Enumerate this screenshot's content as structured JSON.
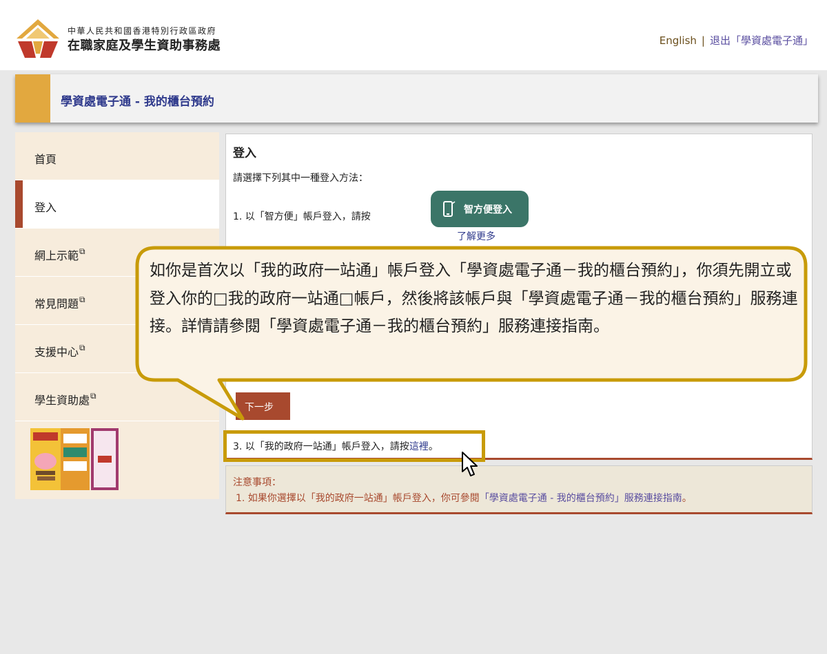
{
  "header": {
    "org_line1": "中華人民共和國香港特別行政區政府",
    "org_line2": "在職家庭及學生資助事務處",
    "english_link": "English",
    "separator": "|",
    "logout_link": "退出「學資處電子通」"
  },
  "title_bar": {
    "title": "學資處電子通 - 我的櫃台預約"
  },
  "sidebar": {
    "items": [
      {
        "label": "首頁",
        "external": false,
        "active": false
      },
      {
        "label": "登入",
        "external": false,
        "active": true
      },
      {
        "label": "網上示範",
        "external": true,
        "active": false
      },
      {
        "label": "常見問題",
        "external": true,
        "active": false
      },
      {
        "label": "支援中心",
        "external": true,
        "active": false
      },
      {
        "label": "學生資助處",
        "external": true,
        "active": false
      }
    ],
    "external_icon": "external-link-icon"
  },
  "content": {
    "title": "登入",
    "instruction": "請選擇下列其中一種登入方法：",
    "option1_text": "1. 以「智方便」帳戶登入，請按",
    "iamsmart_button": "智方便登入",
    "learn_more": "了解更多",
    "next_button": "下一步",
    "option3_prefix": "3. 以「我的政府一站通」帳戶登入，請按",
    "option3_link": "這裡",
    "option3_suffix": "。"
  },
  "notes": {
    "title": "注意事項：",
    "line_prefix": "1. 如果你選擇以「我的政府一站通」帳戶登入，你可參閱",
    "line_link": "「學資處電子通 - 我的櫃台預約」服務連接指南",
    "line_suffix": "。"
  },
  "callout": {
    "text": "如你是首次以「我的政府一站通」帳戶登入「學資處電子通－我的櫃台預約」，你須先開立或登入你的□我的政府一站通□帳戶，然後將該帳戶與「學資處電子通－我的櫃台預約」服務連接。詳情請參閱「學資處電子通－我的櫃台預約」服務連接指南。"
  },
  "colors": {
    "accent_gold": "#e2a83f",
    "brand_brown": "#a8492e",
    "link_blue": "#2f3a8c",
    "iamsmart_green": "#3b7568",
    "highlight_gold": "#c89b09",
    "callout_fill": "#fbf3e6"
  }
}
